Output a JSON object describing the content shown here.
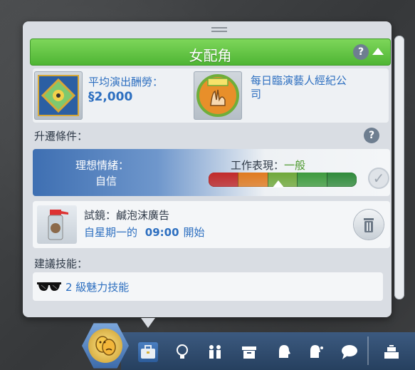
{
  "career_panel": {
    "title": "女配角",
    "help": "?",
    "pay": {
      "label": "平均演出酬勞：",
      "currency": "§",
      "amount": "2,000"
    },
    "agency": {
      "name": "每日臨演藝人經紀公司"
    },
    "promotion": {
      "header": "升遷條件：",
      "help": "?",
      "mood_label": "理想情緒：",
      "mood_value": "自信",
      "performance_label": "工作表現：",
      "performance_value": "一般",
      "performance_level": 0.47
    },
    "task": {
      "title": "試鏡：鹹泡沫廣告",
      "schedule_prefix": "自星期一的",
      "time": "09:00",
      "schedule_suffix": "開始"
    },
    "skills": {
      "header": "建議技能：",
      "item": "2 級魅力技能"
    }
  },
  "colors": {
    "title_green": "#5bbf3e",
    "accent_blue": "#2d6fc0",
    "perf_segments": [
      "#c22a2a",
      "#e07a1f",
      "#6fa83a",
      "#3d9a3d",
      "#2f8a3a"
    ]
  },
  "bottom_bar": {
    "icons": [
      "career-briefcase-icon",
      "lightbulb-icon",
      "family-icon",
      "inventory-box-icon",
      "head-icon",
      "thought-icon",
      "speech-bubble-icon",
      "register-icon"
    ]
  }
}
